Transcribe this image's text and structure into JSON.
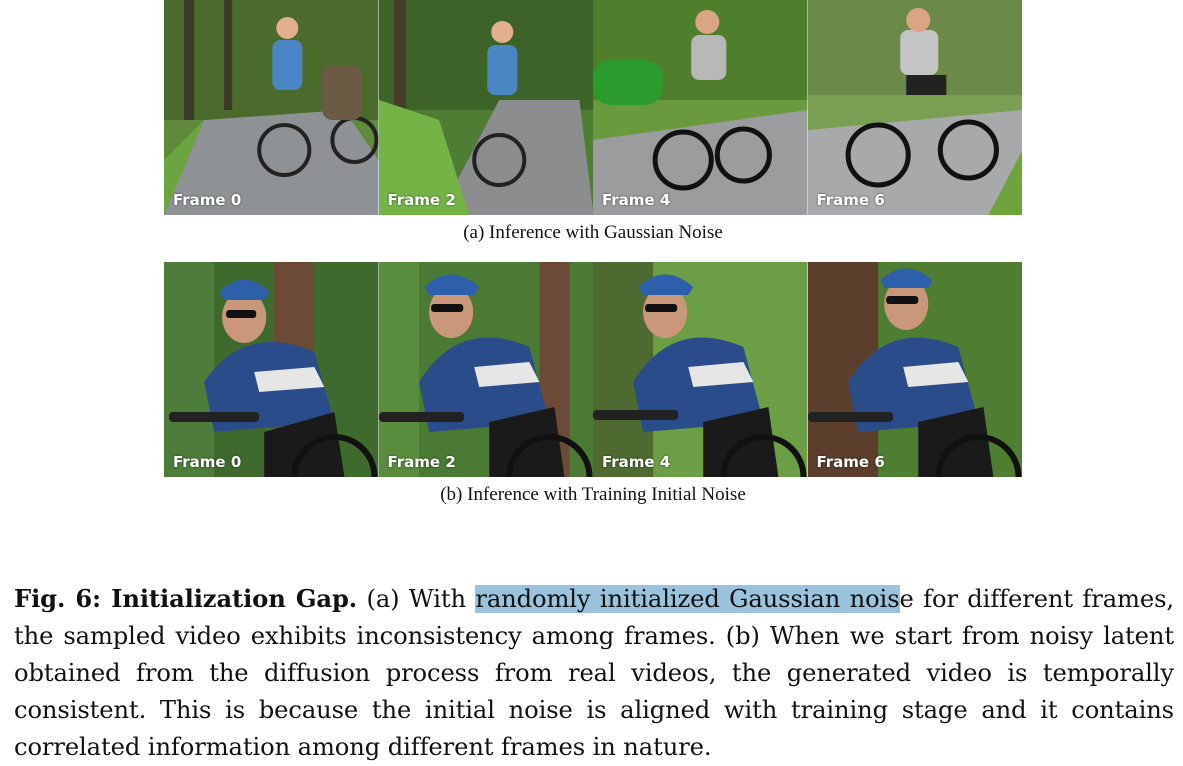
{
  "figure": {
    "row_a": {
      "frames": [
        "Frame 0",
        "Frame 2",
        "Frame 4",
        "Frame 6"
      ],
      "subcaption": "(a) Inference with Gaussian Noise"
    },
    "row_b": {
      "frames": [
        "Frame 0",
        "Frame 2",
        "Frame 4",
        "Frame 6"
      ],
      "subcaption": "(b) Inference with Training Initial Noise"
    }
  },
  "caption": {
    "label": "Fig. 6: Initialization Gap.",
    "text_before": " (a) With ",
    "highlighted": "randomly initialized Gaussian nois",
    "text_after": "e for different frames, the sampled video exhibits inconsistency among frames. (b) When we start from noisy latent obtained from the diffusion process from real videos, the generated video is temporally consistent. This is because the initial noise is aligned with training stage and it contains correlated information among different frames in nature.",
    "highlight_color": "#9cc3de"
  }
}
